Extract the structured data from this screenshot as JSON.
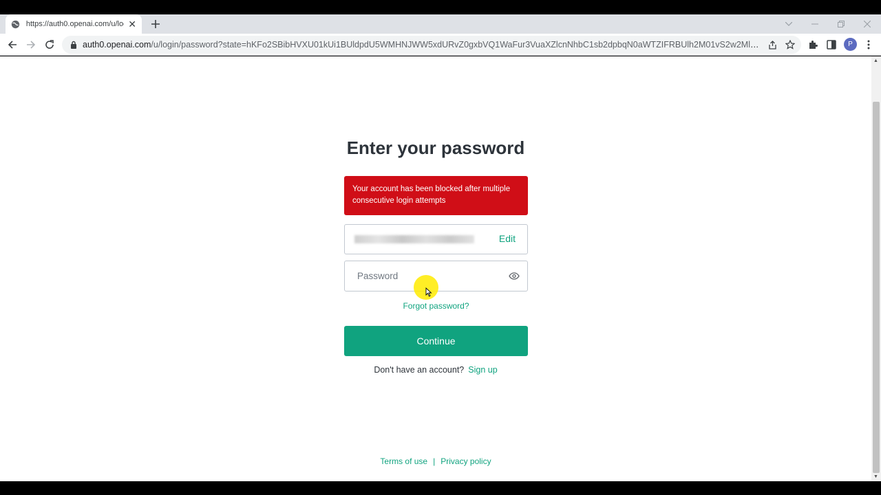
{
  "browser": {
    "tab_title": "https://auth0.openai.com/u/login/password",
    "tab_close_glyph": "✕",
    "new_tab_glyph": "+",
    "url_host": "auth0.openai.com",
    "url_path": "/u/login/password?state=hKFo2SBibHVXU01kUi1BUldpdU5WMHNJWW5xdURvZ0gxbVQ1WaFur3VuaXZlcnNhbC1sb2dpbqN0aWTZIFRBUlh2M01vS2w2MlhpNjVDdUJjLV9ZT...",
    "avatar_letter": "P",
    "icons": [
      "globe-icon",
      "close-icon",
      "plus-icon",
      "chevron-down-icon",
      "minimize-icon",
      "restore-icon",
      "window-close-icon",
      "back-icon",
      "forward-icon",
      "reload-icon",
      "lock-icon",
      "share-icon",
      "star-icon",
      "puzzle-icon",
      "sidepanel-icon",
      "kebab-menu-icon"
    ]
  },
  "login": {
    "heading": "Enter your password",
    "error_message": "Your account has been blocked after multiple consecutive login attempts",
    "email_action": "Edit",
    "password_placeholder": "Password",
    "forgot_password": "Forgot password?",
    "continue_label": "Continue",
    "signup_prompt": "Don't have an account?",
    "signup_link": "Sign up",
    "icons": [
      "eye-icon"
    ]
  },
  "footer": {
    "terms": "Terms of use",
    "separator": "|",
    "privacy": "Privacy policy"
  },
  "colors": {
    "accent": "#10a37f",
    "error": "#d00e17",
    "heading": "#2d333a"
  }
}
